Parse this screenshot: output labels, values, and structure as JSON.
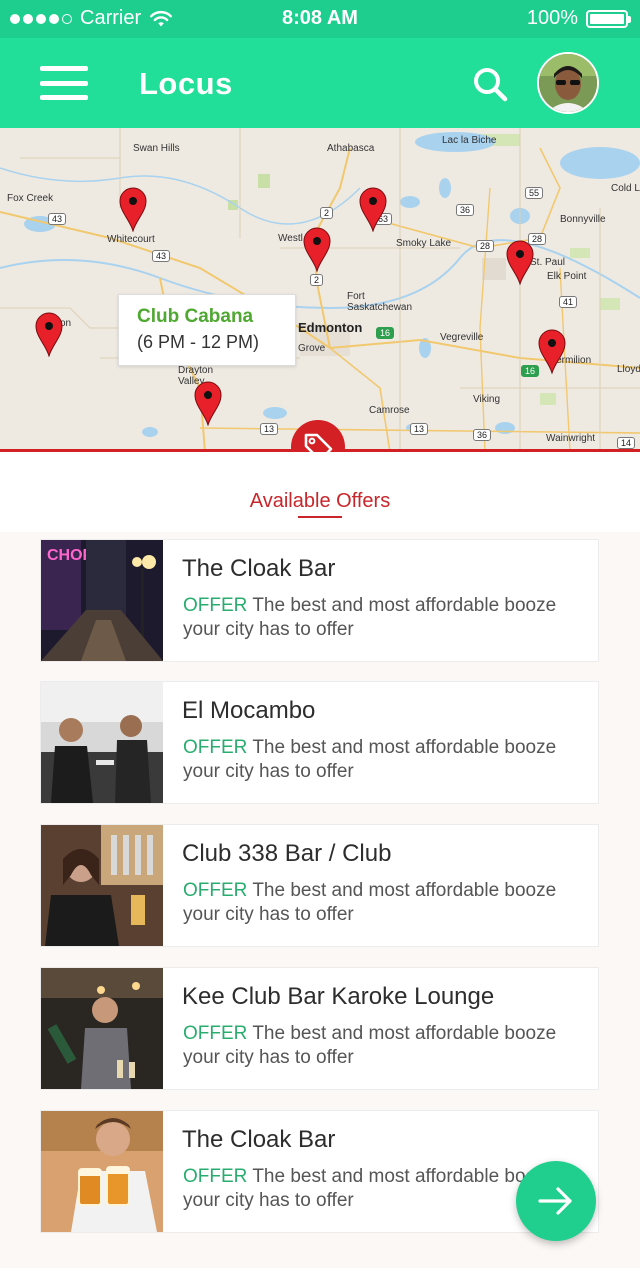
{
  "status_bar": {
    "carrier": "Carrier",
    "time": "8:08 AM",
    "battery": "100%",
    "battery_level": 1.0
  },
  "header": {
    "title": "Locus",
    "menu_icon": "hamburger-menu-icon",
    "search_icon": "search-icon",
    "avatar": "user-avatar"
  },
  "map": {
    "labels": [
      "Swan Hills",
      "Athabasca",
      "Lac la Biche",
      "Fox Creek",
      "Whitecourt",
      "Westl",
      "Smoky Lake",
      "Bonnyville",
      "Cold L",
      "St. Paul",
      "Elk Point",
      "Fort Saskatchewan",
      "Edmonton",
      "Grove",
      "Vegreville",
      "Vermilion",
      "Lloyd",
      "Drayton Valley",
      "Camrose",
      "Viking",
      "Wainwright",
      "on"
    ],
    "road_shields": [
      "43",
      "43",
      "2",
      "2",
      "63",
      "36",
      "28",
      "28",
      "55",
      "41",
      "16",
      "16",
      "13",
      "13",
      "36",
      "14"
    ],
    "pin_icon": "map-pin-icon",
    "pin_color": "#e8202a",
    "tooltip": {
      "name": "Club Cabana",
      "hours": "(6 PM - 12 PM)"
    }
  },
  "offers": {
    "title": "Available Offers",
    "tag_icon": "price-tag-icon",
    "accent_color": "#c8262b",
    "items": [
      {
        "name": "The Cloak Bar",
        "tag": "OFFER",
        "description": "The best and most affordable booze your city has to offer"
      },
      {
        "name": "El Mocambo",
        "tag": "OFFER",
        "description": "The best and most affordable booze your city has to offer"
      },
      {
        "name": "Club 338 Bar / Club",
        "tag": "OFFER",
        "description": "The best and most affordable booze your city has to offer"
      },
      {
        "name": "Kee Club Bar Karoke Lounge",
        "tag": "OFFER",
        "description": "The best and most affordable booze your city has to offer"
      },
      {
        "name": "The Cloak Bar",
        "tag": "OFFER",
        "description": "The best and most affordable booze your city has to offer"
      }
    ]
  },
  "fab": {
    "icon": "arrow-right-icon"
  },
  "colors": {
    "primary": "#21de98",
    "status_bar": "#1dce8e",
    "offer_green": "#29ad6f"
  }
}
